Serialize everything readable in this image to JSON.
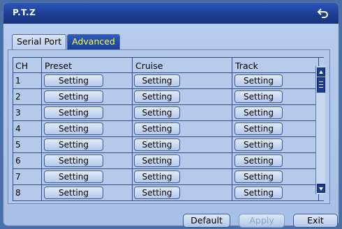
{
  "window": {
    "title": "P.T.Z"
  },
  "tabs": [
    {
      "label": "Serial Port",
      "active": false
    },
    {
      "label": "Advanced",
      "active": true
    }
  ],
  "table": {
    "headers": {
      "ch": "CH",
      "preset": "Preset",
      "cruise": "Cruise",
      "track": "Track"
    },
    "rows": [
      {
        "ch": "1",
        "preset": "Setting",
        "cruise": "Setting",
        "track": "Setting"
      },
      {
        "ch": "2",
        "preset": "Setting",
        "cruise": "Setting",
        "track": "Setting"
      },
      {
        "ch": "3",
        "preset": "Setting",
        "cruise": "Setting",
        "track": "Setting"
      },
      {
        "ch": "4",
        "preset": "Setting",
        "cruise": "Setting",
        "track": "Setting"
      },
      {
        "ch": "5",
        "preset": "Setting",
        "cruise": "Setting",
        "track": "Setting"
      },
      {
        "ch": "6",
        "preset": "Setting",
        "cruise": "Setting",
        "track": "Setting"
      },
      {
        "ch": "7",
        "preset": "Setting",
        "cruise": "Setting",
        "track": "Setting"
      },
      {
        "ch": "8",
        "preset": "Setting",
        "cruise": "Setting",
        "track": "Setting"
      }
    ]
  },
  "footer": {
    "default_label": "Default",
    "apply_label": "Apply",
    "exit_label": "Exit",
    "apply_disabled": true
  },
  "icons": {
    "back": "back-arrow-icon",
    "scroll_up": "scroll-up-icon",
    "scroll_down": "scroll-down-icon"
  },
  "colors": {
    "titlebar": "#1d3f93",
    "active_tab_text": "#ffff33",
    "panel": "#b3c8ea"
  }
}
